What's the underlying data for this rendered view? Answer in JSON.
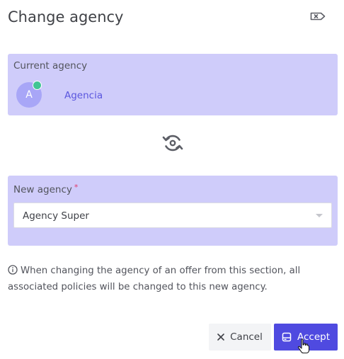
{
  "dialog": {
    "title": "Change agency"
  },
  "current_agency": {
    "label": "Current agency",
    "avatar_initial": "A",
    "name": "Agencia",
    "status_color": "#40c594"
  },
  "new_agency": {
    "label": "New agency",
    "required_mark": "*",
    "selected_value": "Agency Super"
  },
  "info": {
    "text": "When changing the agency of an offer from this section, all associated policies will be changed to this new agency."
  },
  "buttons": {
    "cancel_label": "Cancel",
    "accept_label": "Accept"
  },
  "icons": {
    "close": "backspace-x-icon",
    "swap": "rotate-swap-icon",
    "info": "info-circle-icon",
    "cancel": "x-icon",
    "accept": "save-icon"
  },
  "colors": {
    "panel_background": "#cfccfa",
    "accent": "#4f4ae0",
    "agency_link": "#5a56de",
    "required": "#e23c6b"
  }
}
